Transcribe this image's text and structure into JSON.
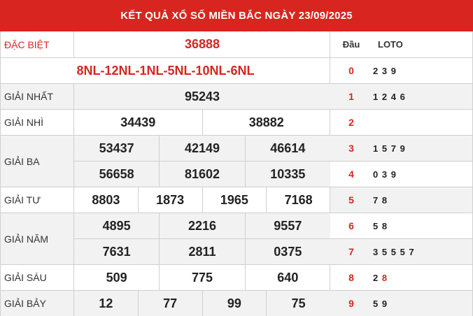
{
  "header": {
    "title": "KẾT QUẢ XỔ SỐ MIỀN BẮC NGÀY 23/09/2025"
  },
  "colors": {
    "accent": "#d8251f",
    "row_shade": "#f2f2f2"
  },
  "results": {
    "special": {
      "label": "ĐẶC BIỆT",
      "value": "36888"
    },
    "codes": "8NL-12NL-1NL-5NL-10NL-6NL",
    "first": {
      "label": "GIẢI NHẤT",
      "values": [
        "95243"
      ]
    },
    "second": {
      "label": "GIẢI NHÌ",
      "values": [
        "34439",
        "38882"
      ]
    },
    "third": {
      "label": "GIẢI BA",
      "values": [
        "53437",
        "42149",
        "46614",
        "56658",
        "81602",
        "10335"
      ]
    },
    "fourth": {
      "label": "GIẢI TƯ",
      "values": [
        "8803",
        "1873",
        "1965",
        "7168"
      ]
    },
    "fifth": {
      "label": "GIẢI NĂM",
      "values": [
        "4895",
        "2216",
        "9557",
        "7631",
        "2811",
        "0375"
      ]
    },
    "sixth": {
      "label": "GIẢI SÁU",
      "values": [
        "509",
        "775",
        "640"
      ]
    },
    "seventh": {
      "label": "GIẢI BẢY",
      "values": [
        "12",
        "77",
        "99",
        "75"
      ]
    }
  },
  "loto": {
    "head_label": "Đầu",
    "loto_label": "LOTO",
    "rows": [
      {
        "head": "0",
        "tails": [
          "2",
          "3",
          "9"
        ]
      },
      {
        "head": "1",
        "tails": [
          "1",
          "2",
          "4",
          "6"
        ]
      },
      {
        "head": "2",
        "tails": []
      },
      {
        "head": "3",
        "tails": [
          "1",
          "5",
          "7",
          "9"
        ]
      },
      {
        "head": "4",
        "tails": [
          "0",
          "3",
          "9"
        ]
      },
      {
        "head": "5",
        "tails": [
          "7",
          "8"
        ]
      },
      {
        "head": "6",
        "tails": [
          "5",
          "8"
        ]
      },
      {
        "head": "7",
        "tails": [
          "3",
          "5",
          "5",
          "5",
          "7"
        ]
      },
      {
        "head": "8",
        "tails": [
          "2",
          "8"
        ],
        "highlight": "8"
      },
      {
        "head": "9",
        "tails": [
          "5",
          "9"
        ]
      }
    ]
  }
}
